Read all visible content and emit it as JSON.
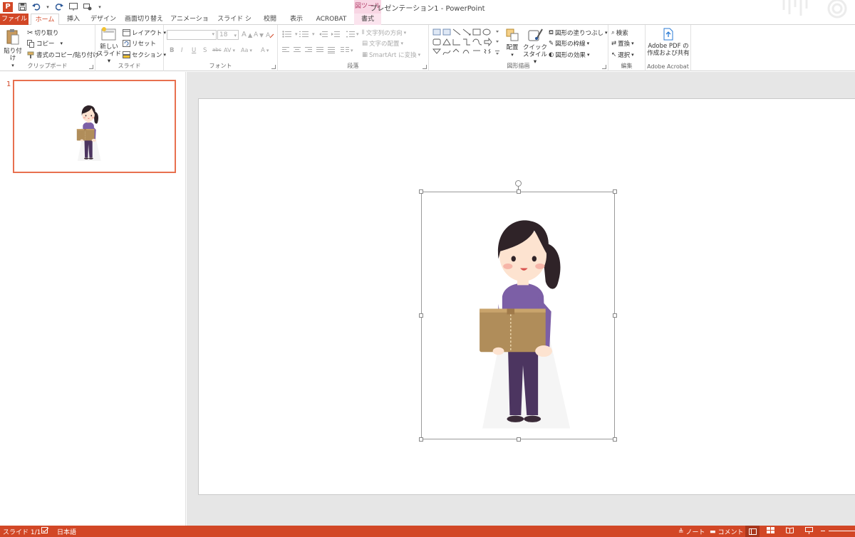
{
  "window": {
    "title": "プレゼンテーション1 - PowerPoint",
    "context_tab_group": "図ツール"
  },
  "qat": {
    "app_icon": "P"
  },
  "tabs": [
    {
      "label": "ファイル",
      "state": "file"
    },
    {
      "label": "ホーム",
      "state": "active"
    },
    {
      "label": "挿入",
      "state": "normal"
    },
    {
      "label": "デザイン",
      "state": "normal"
    },
    {
      "label": "画面切り替え",
      "state": "normal"
    },
    {
      "label": "アニメーション",
      "state": "normal"
    },
    {
      "label": "スライド ショー",
      "state": "normal"
    },
    {
      "label": "校閲",
      "state": "normal"
    },
    {
      "label": "表示",
      "state": "normal"
    },
    {
      "label": "ACROBAT",
      "state": "normal"
    },
    {
      "label": "書式",
      "state": "context"
    }
  ],
  "ribbon": {
    "clipboard": {
      "label": "クリップボード",
      "paste": "貼り付け",
      "cut": "切り取り",
      "copy": "コピー",
      "format_painter": "書式のコピー/貼り付け"
    },
    "slides": {
      "label": "スライド",
      "new_slide_line1": "新しい",
      "new_slide_line2": "スライド",
      "layout": "レイアウト",
      "reset": "リセット",
      "section": "セクション"
    },
    "font": {
      "label": "フォント",
      "font_name": "",
      "font_size": "18",
      "grow": "A",
      "shrink": "A",
      "bold": "B",
      "italic": "I",
      "underline": "U",
      "shadow": "S",
      "strike": "abc",
      "spacing": "AV",
      "case": "Aa",
      "color": "A"
    },
    "paragraph": {
      "label": "段落",
      "text_direction": "文字列の方向",
      "align_text": "文字の配置",
      "smartart": "SmartArt に変換"
    },
    "drawing": {
      "label": "図形描画",
      "arrange": "配置",
      "quick_style_line1": "クイック",
      "quick_style_line2": "スタイル",
      "shape_fill": "図形の塗りつぶし",
      "shape_outline": "図形の枠線",
      "shape_effects": "図形の効果"
    },
    "editing": {
      "label": "編集",
      "find": "検索",
      "replace": "置換",
      "select": "選択"
    },
    "acrobat": {
      "label": "Adobe Acrobat",
      "create_line1": "Adobe PDF の",
      "create_line2": "作成および共有"
    }
  },
  "slides_panel": {
    "slide_number": "1"
  },
  "statusbar": {
    "slide_info": "スライド 1/1",
    "language": "日本語",
    "notes": "ノート",
    "comments": "コメント"
  },
  "colors": {
    "accent": "#d24726",
    "context_tab": "#f8d6e4",
    "sweater": "#7c5fa6",
    "pants": "#4c3560",
    "hair": "#2f2328",
    "skin": "#fde3d0",
    "box": "#b08d5a"
  }
}
